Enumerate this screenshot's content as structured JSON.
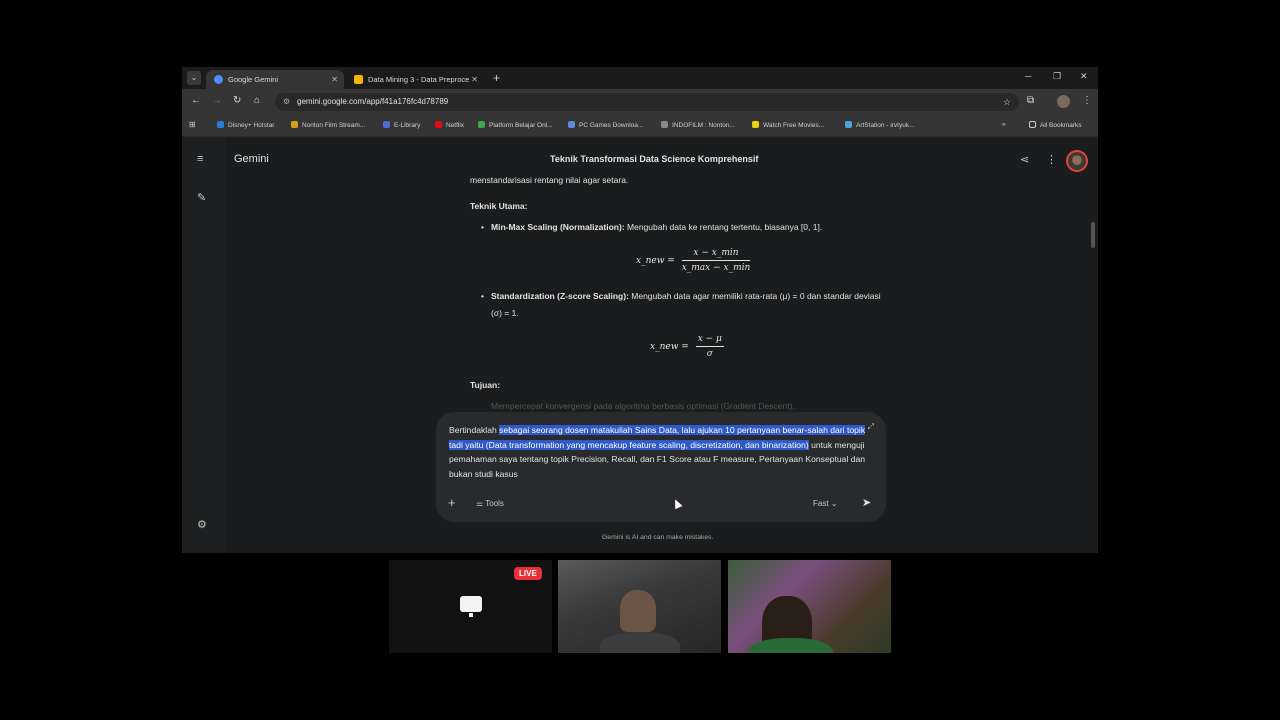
{
  "browser": {
    "tabs": [
      {
        "title": "Google Gemini",
        "active": true,
        "favicon_color": "#4f8ef7"
      },
      {
        "title": "Data Mining 3 - Data Preproce",
        "active": false,
        "favicon_color": "#f4b400"
      }
    ],
    "url": "gemini.google.com/app/f41a176fc4d78789",
    "bookmarks": [
      {
        "label": "Disney+ Hotstar",
        "color": "#2b7bd8"
      },
      {
        "label": "Nonton Film Stream...",
        "color": "#d4a017"
      },
      {
        "label": "E-Library",
        "color": "#4a6fd1"
      },
      {
        "label": "Netflix",
        "color": "#e50914"
      },
      {
        "label": "Platform Belajar Onl...",
        "color": "#3fa84a"
      },
      {
        "label": "PC Games Downloa...",
        "color": "#5a8ad8"
      },
      {
        "label": "INDOFILM : Nonton...",
        "color": "#8a8a8a"
      },
      {
        "label": "Watch Free Movies...",
        "color": "#e8d40a"
      },
      {
        "label": "ArtStation - irvIyuk...",
        "color": "#4aa3df"
      }
    ],
    "all_bookmarks": "All Bookmarks"
  },
  "gemini": {
    "brand": "Gemini",
    "conversation_title": "Teknik Transformasi Data Science Komprehensif",
    "response": {
      "cut_line": "menstandarisasi rentang nilai agar setara.",
      "heading": "Teknik Utama:",
      "bullet1_bold": "Min-Max Scaling (Normalization):",
      "bullet1_text": " Mengubah data ke rentang tertentu, biasanya [0, 1].",
      "formula1_lhs": "x_new =",
      "formula1_num": "x − x_min",
      "formula1_den": "x_max − x_min",
      "bullet2_bold": "Standardization (Z-score Scaling):",
      "bullet2_text": " Mengubah data agar memiliki rata-rata (μ) = 0 dan standar deviasi (σ) = 1.",
      "formula2_lhs": "x_new =",
      "formula2_num": "x − μ",
      "formula2_den": "σ",
      "heading2": "Tujuan:",
      "faded_line": "Mempercepat konvergensi pada algoritma berbasis optimasi (Gradient Descent)."
    },
    "prompt": {
      "pre": "Bertindaklah ",
      "highlighted": "sebagai seorang dosen matakuliah Sains Data, lalu ajukan 10 pertanyaan benar-salah dari topik tadi yaitu (Data transformation yang mencakup feature scaling, discretization, dan binarization)",
      "post": " untuk menguji pemahaman saya tentang topik Precision, Recall, dan F1 Score atau F measure, Pertanyaan Konseptual dan bukan studi kasus",
      "tools_label": "Tools",
      "mode_label": "Fast"
    },
    "disclaimer": "Gemini is AI and can make mistakes."
  },
  "call": {
    "live_label": "LIVE"
  }
}
